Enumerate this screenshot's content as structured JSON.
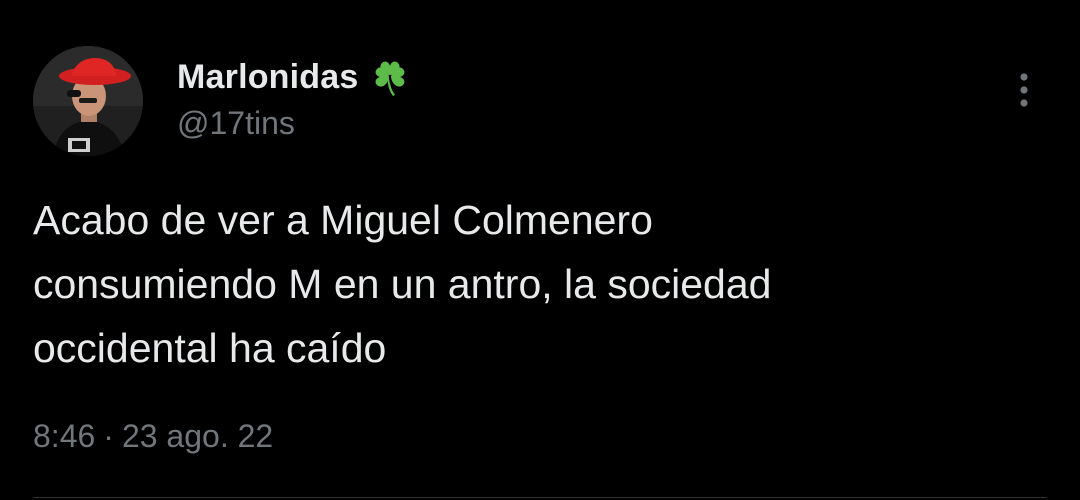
{
  "author": {
    "display_name": "Marlonidas",
    "handle": "@17tins",
    "name_emoji": "shamrock-icon",
    "avatar": "avatar-photo-red-hat"
  },
  "tweet": {
    "text": "Acabo de ver a Miguel Colmenero\nconsumiendo M en un antro, la sociedad\noccidental ha caído",
    "time": "8:46",
    "separator": "·",
    "date": "23 ago. 22"
  },
  "menu": {
    "icon": "more-vertical-icon"
  },
  "colors": {
    "background": "#000000",
    "primary_text": "#e7e9ea",
    "secondary_text": "#71767b",
    "emoji_green": "#5dbb4a",
    "divider": "#2f3336"
  }
}
